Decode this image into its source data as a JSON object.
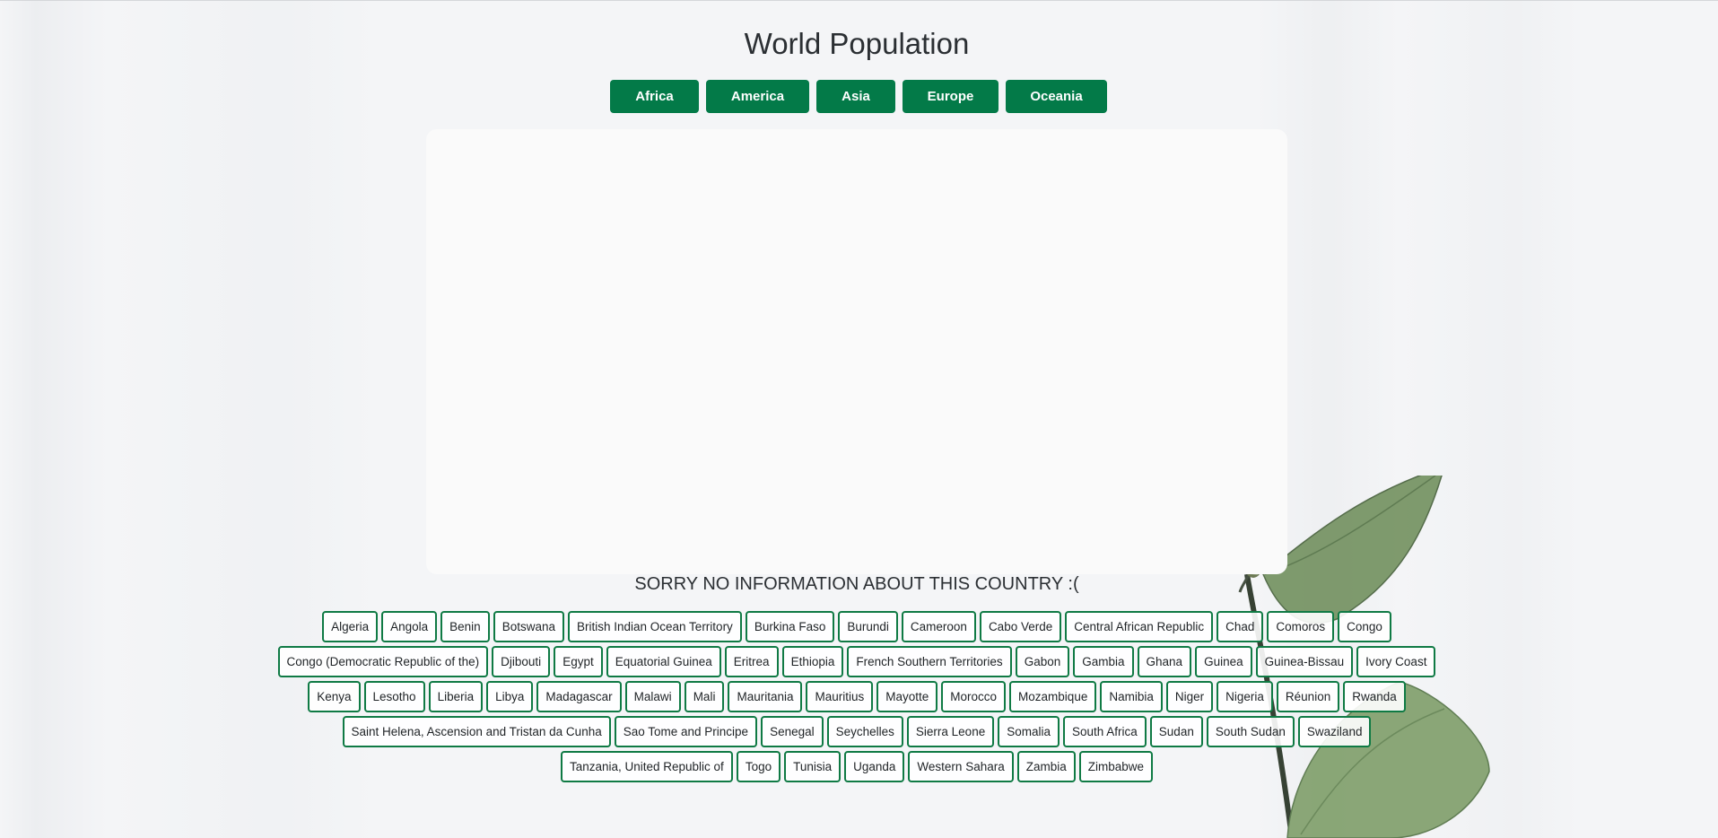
{
  "title": "World Population",
  "regions": [
    "Africa",
    "America",
    "Asia",
    "Europe",
    "Oceania"
  ],
  "message": "SORRY NO INFORMATION ABOUT THIS COUNTRY :(",
  "colors": {
    "accent": "#037a48",
    "background": "#f4f5f7",
    "panel": "#fafafa"
  },
  "countries": [
    "Algeria",
    "Angola",
    "Benin",
    "Botswana",
    "British Indian Ocean Territory",
    "Burkina Faso",
    "Burundi",
    "Cameroon",
    "Cabo Verde",
    "Central African Republic",
    "Chad",
    "Comoros",
    "Congo",
    "Congo (Democratic Republic of the)",
    "Djibouti",
    "Egypt",
    "Equatorial Guinea",
    "Eritrea",
    "Ethiopia",
    "French Southern Territories",
    "Gabon",
    "Gambia",
    "Ghana",
    "Guinea",
    "Guinea-Bissau",
    "Ivory Coast",
    "Kenya",
    "Lesotho",
    "Liberia",
    "Libya",
    "Madagascar",
    "Malawi",
    "Mali",
    "Mauritania",
    "Mauritius",
    "Mayotte",
    "Morocco",
    "Mozambique",
    "Namibia",
    "Niger",
    "Nigeria",
    "Réunion",
    "Rwanda",
    "Saint Helena, Ascension and Tristan da Cunha",
    "Sao Tome and Principe",
    "Senegal",
    "Seychelles",
    "Sierra Leone",
    "Somalia",
    "South Africa",
    "Sudan",
    "South Sudan",
    "Swaziland",
    "Tanzania, United Republic of",
    "Togo",
    "Tunisia",
    "Uganda",
    "Western Sahara",
    "Zambia",
    "Zimbabwe"
  ]
}
